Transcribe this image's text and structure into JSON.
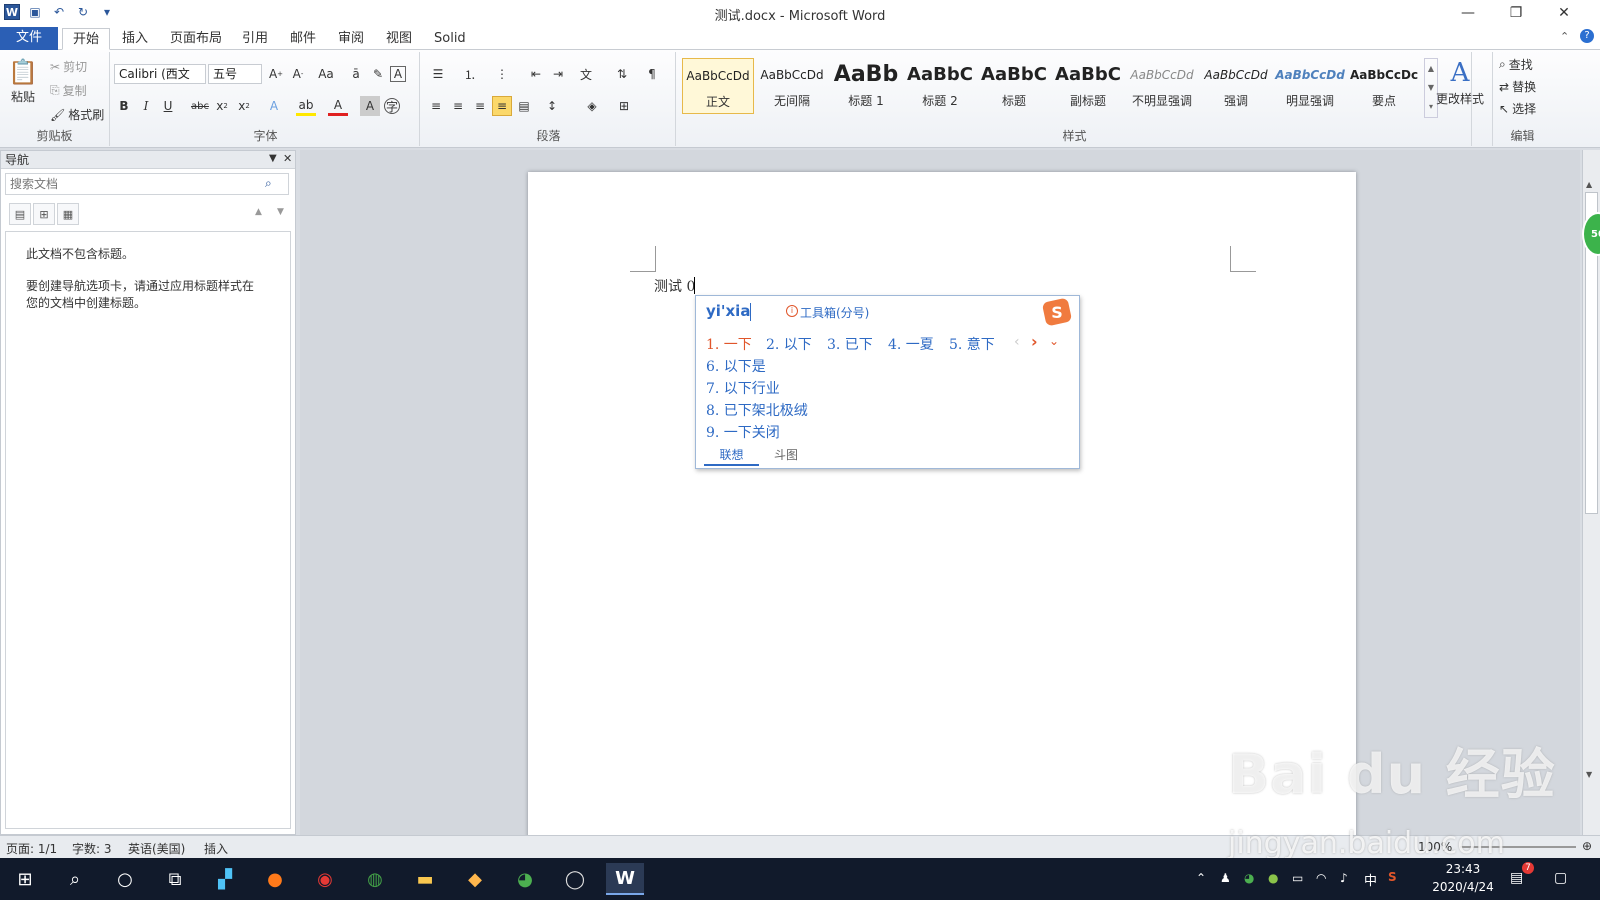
{
  "window": {
    "title": "测试.docx - Microsoft Word",
    "app_icon": "W",
    "controls": {
      "minimize": "—",
      "restore": "❐",
      "close": "✕"
    }
  },
  "tabs": [
    {
      "label": "文件"
    },
    {
      "label": "开始"
    },
    {
      "label": "插入"
    },
    {
      "label": "页面布局"
    },
    {
      "label": "引用"
    },
    {
      "label": "邮件"
    },
    {
      "label": "审阅"
    },
    {
      "label": "视图"
    },
    {
      "label": "Solid"
    }
  ],
  "ribbon": {
    "clipboard": {
      "label": "剪贴板",
      "paste": "粘贴",
      "cut": "剪切",
      "copy": "复制",
      "format_painter": "格式刷"
    },
    "font": {
      "label": "字体",
      "font_name": "Calibri (西文",
      "font_size": "五号"
    },
    "paragraph": {
      "label": "段落"
    },
    "styles": {
      "label": "样式",
      "items": [
        {
          "preview": "AaBbCcDd",
          "name": "正文"
        },
        {
          "preview": "AaBbCcDd",
          "name": "无间隔"
        },
        {
          "preview": "AaBb",
          "name": "标题 1"
        },
        {
          "preview": "AaBbC",
          "name": "标题 2"
        },
        {
          "preview": "AaBbC",
          "name": "标题"
        },
        {
          "preview": "AaBbC",
          "name": "副标题"
        },
        {
          "preview": "AaBbCcDd",
          "name": "不明显强调"
        },
        {
          "preview": "AaBbCcDd",
          "name": "强调"
        },
        {
          "preview": "AaBbCcDd",
          "name": "明显强调"
        },
        {
          "preview": "AaBbCcDc",
          "name": "要点"
        }
      ],
      "change_styles": "更改样式"
    },
    "editing": {
      "label": "编辑",
      "find": "查找",
      "replace": "替换",
      "select": "选择"
    }
  },
  "nav": {
    "title": "导航",
    "search_placeholder": "搜索文档",
    "msg1": "此文档不包含标题。",
    "msg2a": "要创建导航选项卡，请通过应用标题样式在",
    "msg2b": "您的文档中创建标题。"
  },
  "document": {
    "text": "测试 0"
  },
  "ime": {
    "pinyin": "yi'xia",
    "toolbox": "工具箱(分号)",
    "candidates_row1": [
      "1. 一下",
      "2. 以下",
      "3. 已下",
      "4. 一夏",
      "5. 意下"
    ],
    "candidates_more": [
      "6. 以下是",
      "7. 以下行业",
      "8. 已下架北极绒",
      "9. 一下关闭"
    ],
    "tabs": [
      "联想",
      "斗图"
    ]
  },
  "status": {
    "page": "页面: 1/1",
    "words": "字数: 3",
    "language": "英语(美国)",
    "mode": "插入",
    "zoom": "100%"
  },
  "taskbar": {
    "time": "23:43",
    "date": "2020/4/24",
    "ime_lang": "中",
    "notif_count": "7"
  },
  "watermark": {
    "line1": "Bai du 经验",
    "line2": "jingyan.baidu.com"
  },
  "badge": "50",
  "colors": {
    "accent": "#2b579a",
    "file_tab": "#2b5fb5",
    "ime_blue": "#2e6ac4",
    "ime_first": "#e0562b",
    "taskbar": "#111a2b"
  }
}
